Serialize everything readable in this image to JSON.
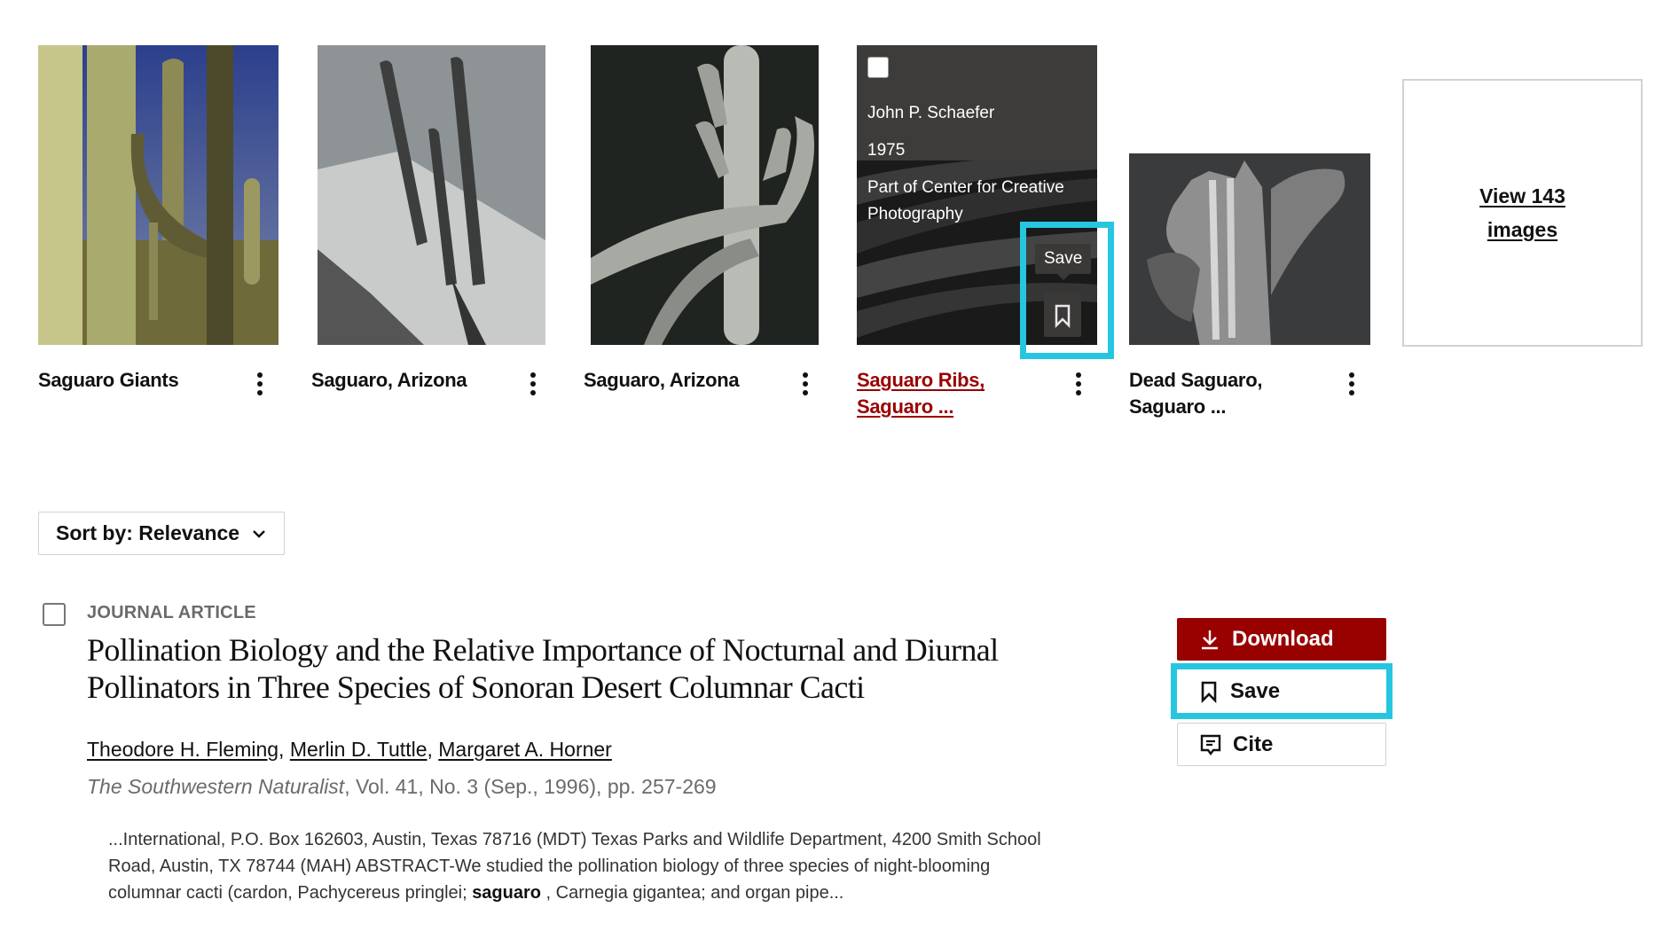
{
  "image_results": {
    "items": [
      {
        "title": "Saguaro Giants",
        "title_line2": "",
        "active": false
      },
      {
        "title": "Saguaro, Arizona",
        "title_line2": "",
        "active": false
      },
      {
        "title": "Saguaro, Arizona",
        "title_line2": "",
        "active": false
      },
      {
        "title": "Saguaro Ribs,",
        "title_line2": "Saguaro ...",
        "active": true,
        "overlay": {
          "creator": "John P. Schaefer",
          "date": "1975",
          "collection": "Part of Center for Creative Photography"
        },
        "tooltip": "Save"
      },
      {
        "title": "Dead Saguaro,",
        "title_line2": "Saguaro ...",
        "active": false
      }
    ],
    "view_all": {
      "line1": "View 143",
      "line2": "images"
    }
  },
  "sort": {
    "label": "Sort by: Relevance"
  },
  "result": {
    "type": "JOURNAL ARTICLE",
    "title_line1": "Pollination Biology and the Relative Importance of Nocturnal and Diurnal",
    "title_line2": "Pollinators in Three Species of Sonoran Desert Columnar Cacti",
    "authors": [
      "Theodore H. Fleming",
      "Merlin D. Tuttle",
      "Margaret A. Horner"
    ],
    "author_sep": ", ",
    "journal_name": "The Southwestern Naturalist",
    "journal_details": ", Vol. 41, No. 3 (Sep., 1996), pp. 257-269",
    "snippet_before": "...International, P.O. Box 162603, Austin, Texas 78716 (MDT) Texas Parks and Wildlife Department, 4200 Smith School Road, Austin, TX 78744 (MAH) ABSTRACT-We studied the pollination biology of three species of night-blooming columnar cacti (cardon, Pachycereus pringlei; ",
    "snippet_highlight": "saguaro",
    "snippet_after": " , Carnegia gigantea; and organ pipe..."
  },
  "actions": {
    "download_label": "Download",
    "save_label": "Save",
    "cite_label": "Cite"
  },
  "colors": {
    "brand_red": "#990000",
    "highlight": "#26c6e0",
    "overlay": "#3d3c3b"
  }
}
